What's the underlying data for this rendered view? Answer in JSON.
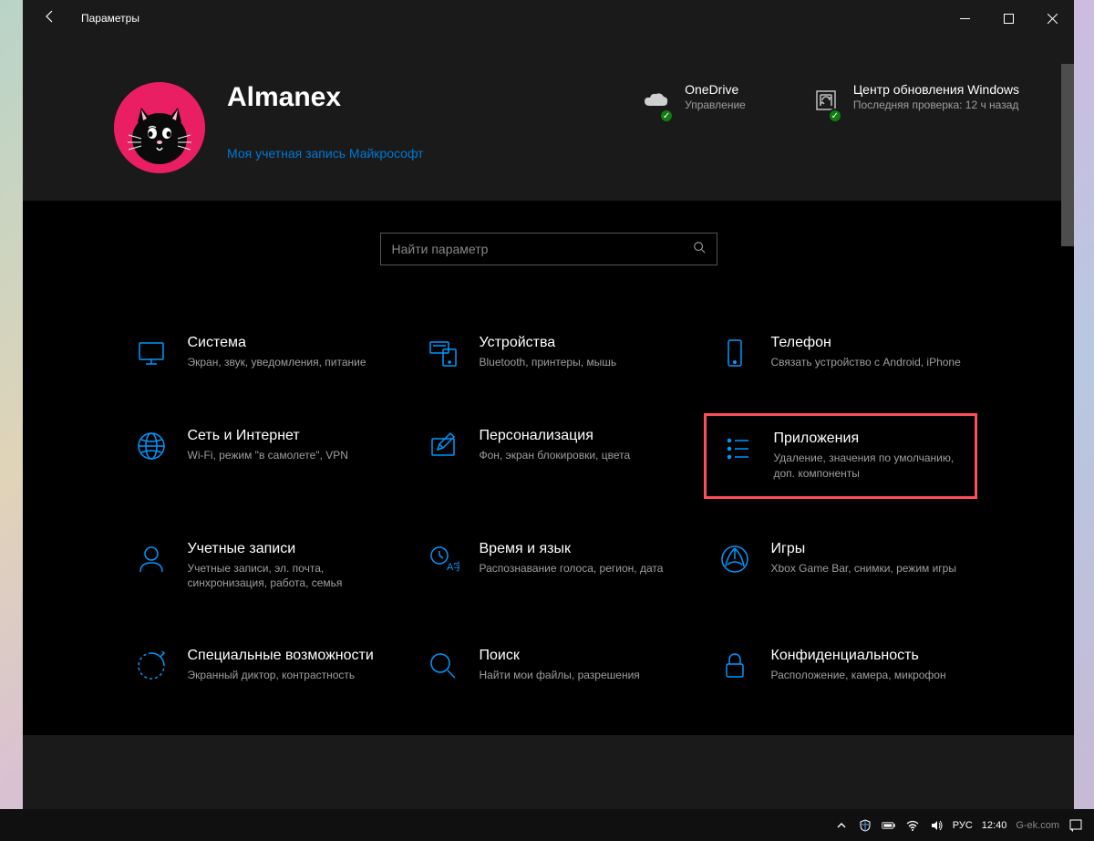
{
  "window": {
    "title": "Параметры"
  },
  "profile": {
    "name": "Almanex",
    "account_link": "Моя учетная запись Майкрософт"
  },
  "status": {
    "onedrive": {
      "title": "OneDrive",
      "subtitle": "Управление"
    },
    "update": {
      "title": "Центр обновления Windows",
      "subtitle": "Последняя проверка: 12 ч назад"
    }
  },
  "search": {
    "placeholder": "Найти параметр"
  },
  "categories": [
    {
      "title": "Система",
      "desc": "Экран, звук, уведомления, питание"
    },
    {
      "title": "Устройства",
      "desc": "Bluetooth, принтеры, мышь"
    },
    {
      "title": "Телефон",
      "desc": "Связать устройство с Android, iPhone"
    },
    {
      "title": "Сеть и Интернет",
      "desc": "Wi-Fi, режим \"в самолете\", VPN"
    },
    {
      "title": "Персонализация",
      "desc": "Фон, экран блокировки, цвета"
    },
    {
      "title": "Приложения",
      "desc": "Удаление, значения по умолчанию, доп. компоненты"
    },
    {
      "title": "Учетные записи",
      "desc": "Учетные записи, эл. почта, синхронизация, работа, семья"
    },
    {
      "title": "Время и язык",
      "desc": "Распознавание голоса, регион, дата"
    },
    {
      "title": "Игры",
      "desc": "Xbox Game Bar, снимки, режим игры"
    },
    {
      "title": "Специальные возможности",
      "desc": "Экранный диктор, контрастность"
    },
    {
      "title": "Поиск",
      "desc": "Найти мои файлы, разрешения"
    },
    {
      "title": "Конфиденциальность",
      "desc": "Расположение, камера, микрофон"
    }
  ],
  "taskbar": {
    "lang": "РУС",
    "time": "12:40",
    "watermark": "G-ek.com"
  }
}
